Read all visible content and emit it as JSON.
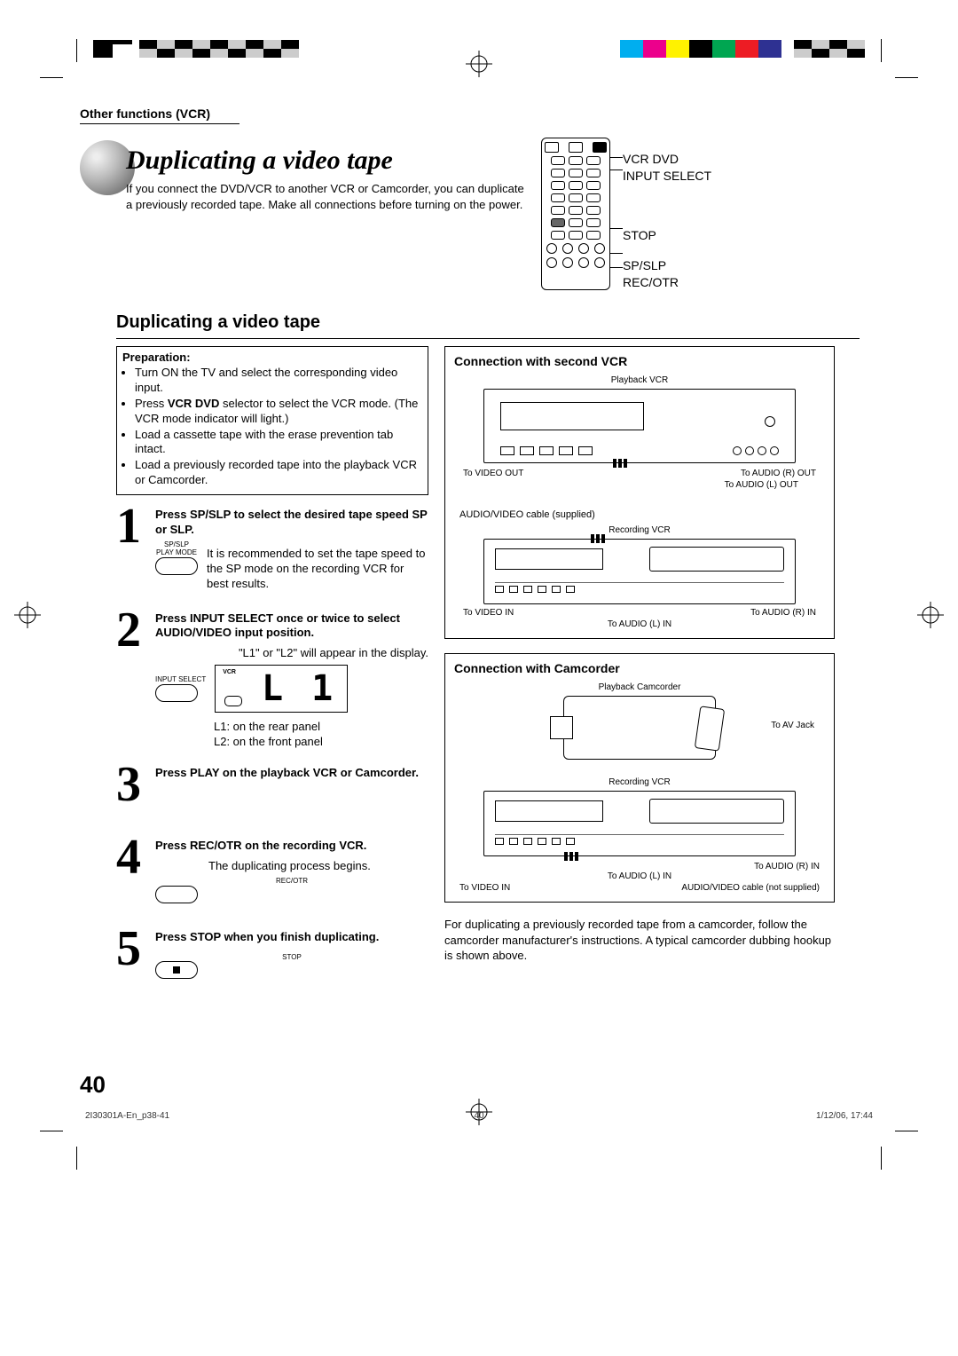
{
  "breadcrumb": "Other functions (VCR)",
  "title": "Duplicating a video tape",
  "intro": "If you connect the DVD/VCR to another VCR or Camcorder, you can duplicate a previously recorded tape. Make all connections before turning on the power.",
  "remote_labels": {
    "l1": "VCR DVD",
    "l2": "INPUT SELECT",
    "l3": "STOP",
    "l4": "SP/SLP",
    "l5": "REC/OTR"
  },
  "section_heading": "Duplicating a video tape",
  "preparation": {
    "title": "Preparation:",
    "items": [
      "Turn ON the TV and select the corresponding video input.",
      "Press VCR DVD selector to select the VCR mode. (The VCR mode indicator will light.)",
      "Load a cassette tape with the erase prevention tab intact.",
      "Load a previously recorded tape into the playback VCR or Camcorder."
    ]
  },
  "steps": [
    {
      "num": "1",
      "head": "Press SP/SLP to select the desired tape speed SP or SLP.",
      "btn_top": "SP/SLP",
      "btn_bot": "PLAY MODE",
      "note": "It is recommended to set the tape speed to the SP mode on the recording VCR for best results."
    },
    {
      "num": "2",
      "head": "Press INPUT SELECT once or twice to select AUDIO/VIDEO input position.",
      "note1": "\"L1\" or \"L2\" will appear in the display.",
      "btn_top": "INPUT SELECT",
      "disp_vcr": "VCR",
      "disp_val": "L 1",
      "note2": "L1: on the rear panel",
      "note3": "L2: on the front panel"
    },
    {
      "num": "3",
      "head": "Press PLAY on the playback VCR or Camcorder."
    },
    {
      "num": "4",
      "head": "Press REC/OTR on the recording VCR.",
      "note": "The duplicating process begins.",
      "btn_top": "REC/OTR"
    },
    {
      "num": "5",
      "head": "Press STOP when you finish duplicating.",
      "btn_top": "STOP"
    }
  ],
  "right": {
    "box1_title": "Connection with second VCR",
    "playback_vcr": "Playback VCR",
    "to_video_out": "To VIDEO OUT",
    "to_audio_r_out": "To AUDIO (R) OUT",
    "to_audio_l_out": "To AUDIO (L) OUT",
    "cable1": "AUDIO/VIDEO cable (supplied)",
    "recording_vcr": "Recording VCR",
    "to_video_in": "To VIDEO IN",
    "to_audio_r_in": "To AUDIO (R) IN",
    "to_audio_l_in": "To AUDIO (L) IN",
    "box2_title": "Connection with Camcorder",
    "playback_cam": "Playback Camcorder",
    "av_jack": "To AV Jack",
    "cable2": "AUDIO/VIDEO cable (not supplied)",
    "para": "For duplicating a previously recorded tape from a camcorder, follow the camcorder manufacturer's instructions. A typical camcorder dubbing hookup is shown above."
  },
  "page_num": "40",
  "footer": {
    "left": "2I30301A-En_p38-41",
    "mid": "40",
    "right": "1/12/06, 17:44"
  }
}
